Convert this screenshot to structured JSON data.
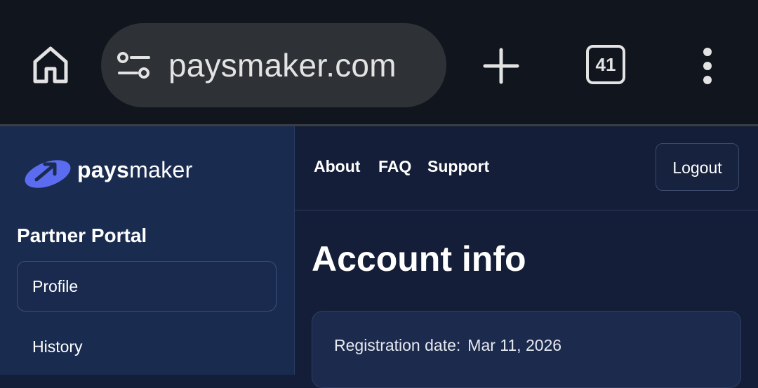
{
  "browser": {
    "url": "paysmaker.com",
    "tab_count": "41",
    "icons": [
      "home-icon",
      "site-settings-icon",
      "new-tab-icon",
      "tab-switcher-icon",
      "more-menu-icon"
    ]
  },
  "sidebar": {
    "brand_bold": "pays",
    "brand_rest": "maker",
    "portal_title": "Partner Portal",
    "items": [
      {
        "label": "Profile",
        "active": true
      },
      {
        "label": "History",
        "active": false
      }
    ]
  },
  "topnav": {
    "links": [
      {
        "label": "About"
      },
      {
        "label": "FAQ"
      },
      {
        "label": "Support"
      }
    ],
    "logout_label": "Logout"
  },
  "main": {
    "title": "Account info",
    "registration_label": "Registration date:",
    "registration_value": "Mar 11, 2026"
  },
  "colors": {
    "chrome_bg": "#11151e",
    "urlbar_bg": "#2e3136",
    "sidebar_bg": "#1a2b50",
    "main_bg": "#141e38",
    "logo_accent": "#5b6cf0"
  }
}
